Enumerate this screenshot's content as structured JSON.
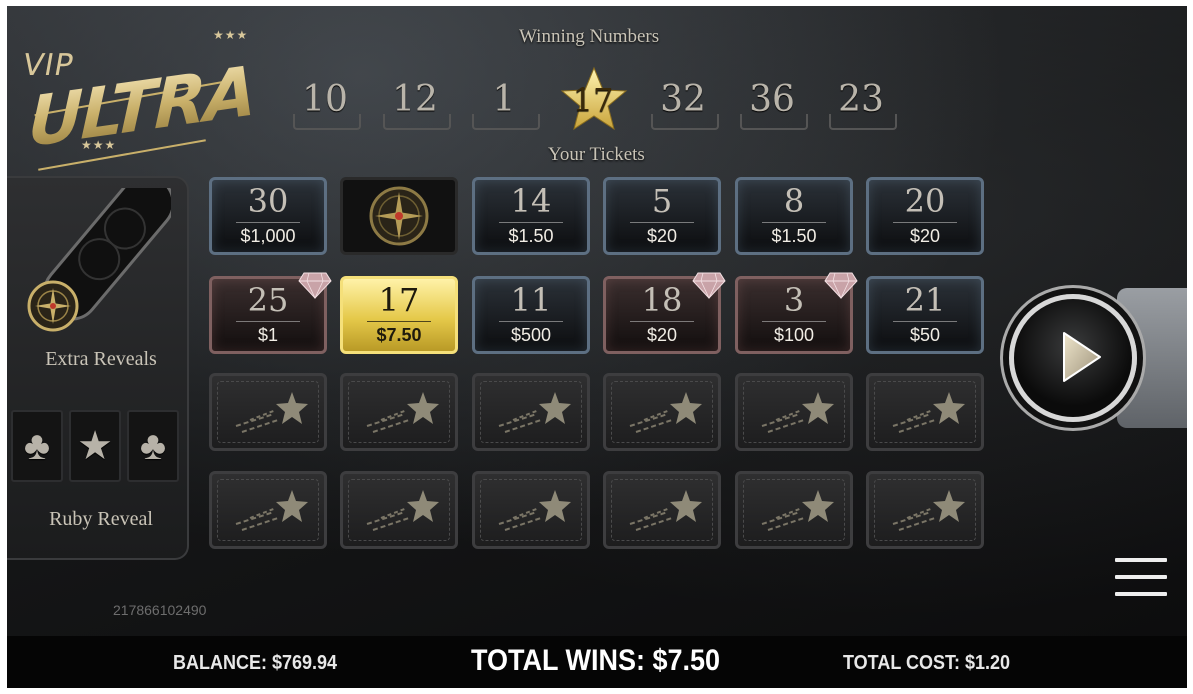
{
  "logo": {
    "vip": "VIP",
    "ultra": "ULTRA",
    "stars": "★★★"
  },
  "winning_numbers_title": "Winning Numbers",
  "winning_numbers": [
    "10",
    "12",
    "1",
    "17",
    "32",
    "36",
    "23"
  ],
  "highlighted_winning_number": "17",
  "your_tickets_title": "Your Tickets",
  "tickets_row1": [
    {
      "number": "30",
      "prize": "$1,000",
      "style": "blue"
    },
    {
      "special": "compass-icon",
      "style": "special"
    },
    {
      "number": "14",
      "prize": "$1.50",
      "style": "blue"
    },
    {
      "number": "5",
      "prize": "$20",
      "style": "blue"
    },
    {
      "number": "8",
      "prize": "$1.50",
      "style": "blue"
    },
    {
      "number": "20",
      "prize": "$20",
      "style": "blue"
    }
  ],
  "tickets_row2": [
    {
      "number": "25",
      "prize": "$1",
      "style": "ruby",
      "gem": true
    },
    {
      "number": "17",
      "prize": "$7.50",
      "style": "gold"
    },
    {
      "number": "11",
      "prize": "$500",
      "style": "blue"
    },
    {
      "number": "18",
      "prize": "$20",
      "style": "ruby",
      "gem": true
    },
    {
      "number": "3",
      "prize": "$100",
      "style": "ruby",
      "gem": true
    },
    {
      "number": "21",
      "prize": "$50",
      "style": "blue"
    }
  ],
  "left_panel": {
    "extra_reveals_label": "Extra Reveals",
    "ruby_reveal_label": "Ruby Reveal",
    "ruby_slots": [
      "club-icon",
      "star-icon",
      "club-icon"
    ]
  },
  "ticket_id": "217866102490",
  "bottom_bar": {
    "balance": "BALANCE: $769.94",
    "total_wins": "TOTAL WINS: $7.50",
    "total_cost": "TOTAL COST: $1.20"
  },
  "colors": {
    "gold": "#e5c94a",
    "blue_border": "#5d6f82",
    "ruby_border": "#7f6060",
    "gem": "#c9a3a8"
  }
}
